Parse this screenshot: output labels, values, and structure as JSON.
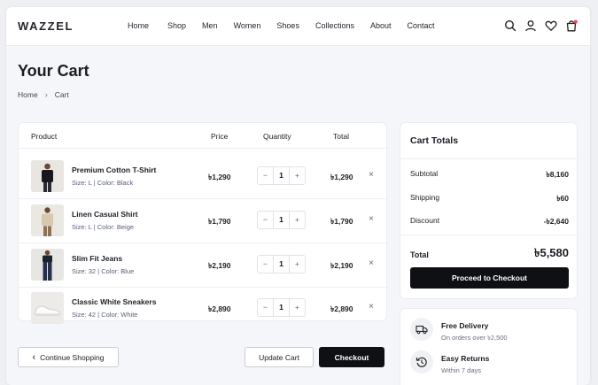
{
  "brand": "WAZZEL",
  "nav": [
    "Home",
    "Shop",
    "Men",
    "Women",
    "Shoes",
    "Collections",
    "About",
    "Contact"
  ],
  "header_icons": [
    "search-icon",
    "user-icon",
    "heart-icon",
    "bag-icon"
  ],
  "page_title": "Your Cart",
  "breadcrumb": {
    "home": "Home",
    "separator": "›",
    "current": "Cart"
  },
  "table": {
    "headers": {
      "product": "Product",
      "price": "Price",
      "quantity": "Quantity",
      "total": "Total"
    },
    "items": [
      {
        "name": "Premium Cotton T-Shirt",
        "meta": "Size: L | Color: Black",
        "price": "৳1,290",
        "qty": "1",
        "total": "৳1,290"
      },
      {
        "name": "Linen Casual Shirt",
        "meta": "Size: L | Color: Beige",
        "price": "৳1,790",
        "qty": "1",
        "total": "৳1,790"
      },
      {
        "name": "Slim Fit Jeans",
        "meta": "Size: 32 | Color: Blue",
        "price": "৳2,190",
        "qty": "1",
        "total": "৳2,190"
      },
      {
        "name": "Classic White Sneakers",
        "meta": "Size: 42 | Color: White",
        "price": "৳2,890",
        "qty": "1",
        "total": "৳2,890"
      }
    ],
    "minus": "−",
    "plus": "+",
    "remove": "×"
  },
  "actions": {
    "continue": "Continue Shopping",
    "continue_icon": "‹",
    "update": "Update Cart",
    "checkout": "Checkout"
  },
  "totals": {
    "title": "Cart Totals",
    "subtotal_label": "Subtotal",
    "subtotal": "৳8,160",
    "shipping_label": "Shipping",
    "shipping": "৳60",
    "discount_label": "Discount",
    "discount": "-৳2,640",
    "total_label": "Total",
    "total": "৳5,580",
    "proceed": "Proceed to Checkout"
  },
  "perks": [
    {
      "icon": "truck-icon",
      "title": "Free Delivery",
      "sub": "On orders over ৳2,500"
    },
    {
      "icon": "returns-icon",
      "title": "Easy Returns",
      "sub": "Within 7 days"
    }
  ],
  "colors": {
    "dark": "#0f1014",
    "background": "#f5f6f9",
    "accent_badge": "#e5484d"
  }
}
